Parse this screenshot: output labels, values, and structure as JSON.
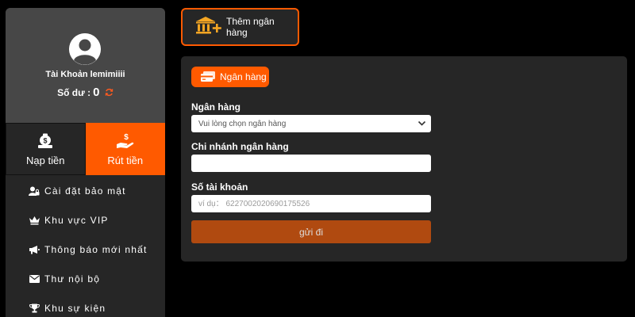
{
  "profile": {
    "username": "Tài Khoản lemimiiii",
    "balance_label": "Số dư :",
    "balance_value": "0"
  },
  "actions": {
    "deposit_label": "Nạp tiền",
    "withdraw_label": "Rút tiền"
  },
  "menu": [
    {
      "label": "Cài đặt bảo mật",
      "icon": "user-lock-icon"
    },
    {
      "label": "Khu vực VIP",
      "icon": "crown-icon"
    },
    {
      "label": "Thông báo mới nhất",
      "icon": "megaphone-icon"
    },
    {
      "label": "Thư nội bộ",
      "icon": "envelope-icon"
    },
    {
      "label": "Khu sự kiện",
      "icon": "trophy-icon"
    }
  ],
  "add_bank_button": {
    "label": "Thêm ngân hàng",
    "icon": "bank-add-icon"
  },
  "form": {
    "tab_label": "Ngân hàng",
    "bank_label": "Ngân hàng",
    "bank_select_value": "Vui lòng chọn ngân hàng",
    "branch_label": "Chi nhánh ngân hàng",
    "branch_value": "",
    "account_label": "Số tài khoản",
    "account_placeholder": "ví dụ： 6227002020690175526",
    "submit_label": "gửi đi"
  },
  "colors": {
    "accent": "#ff5a00",
    "sidebar_bg": "#262626",
    "profile_bg": "#474747",
    "submit_bg": "#b04a10",
    "page_bg": "#000000"
  }
}
